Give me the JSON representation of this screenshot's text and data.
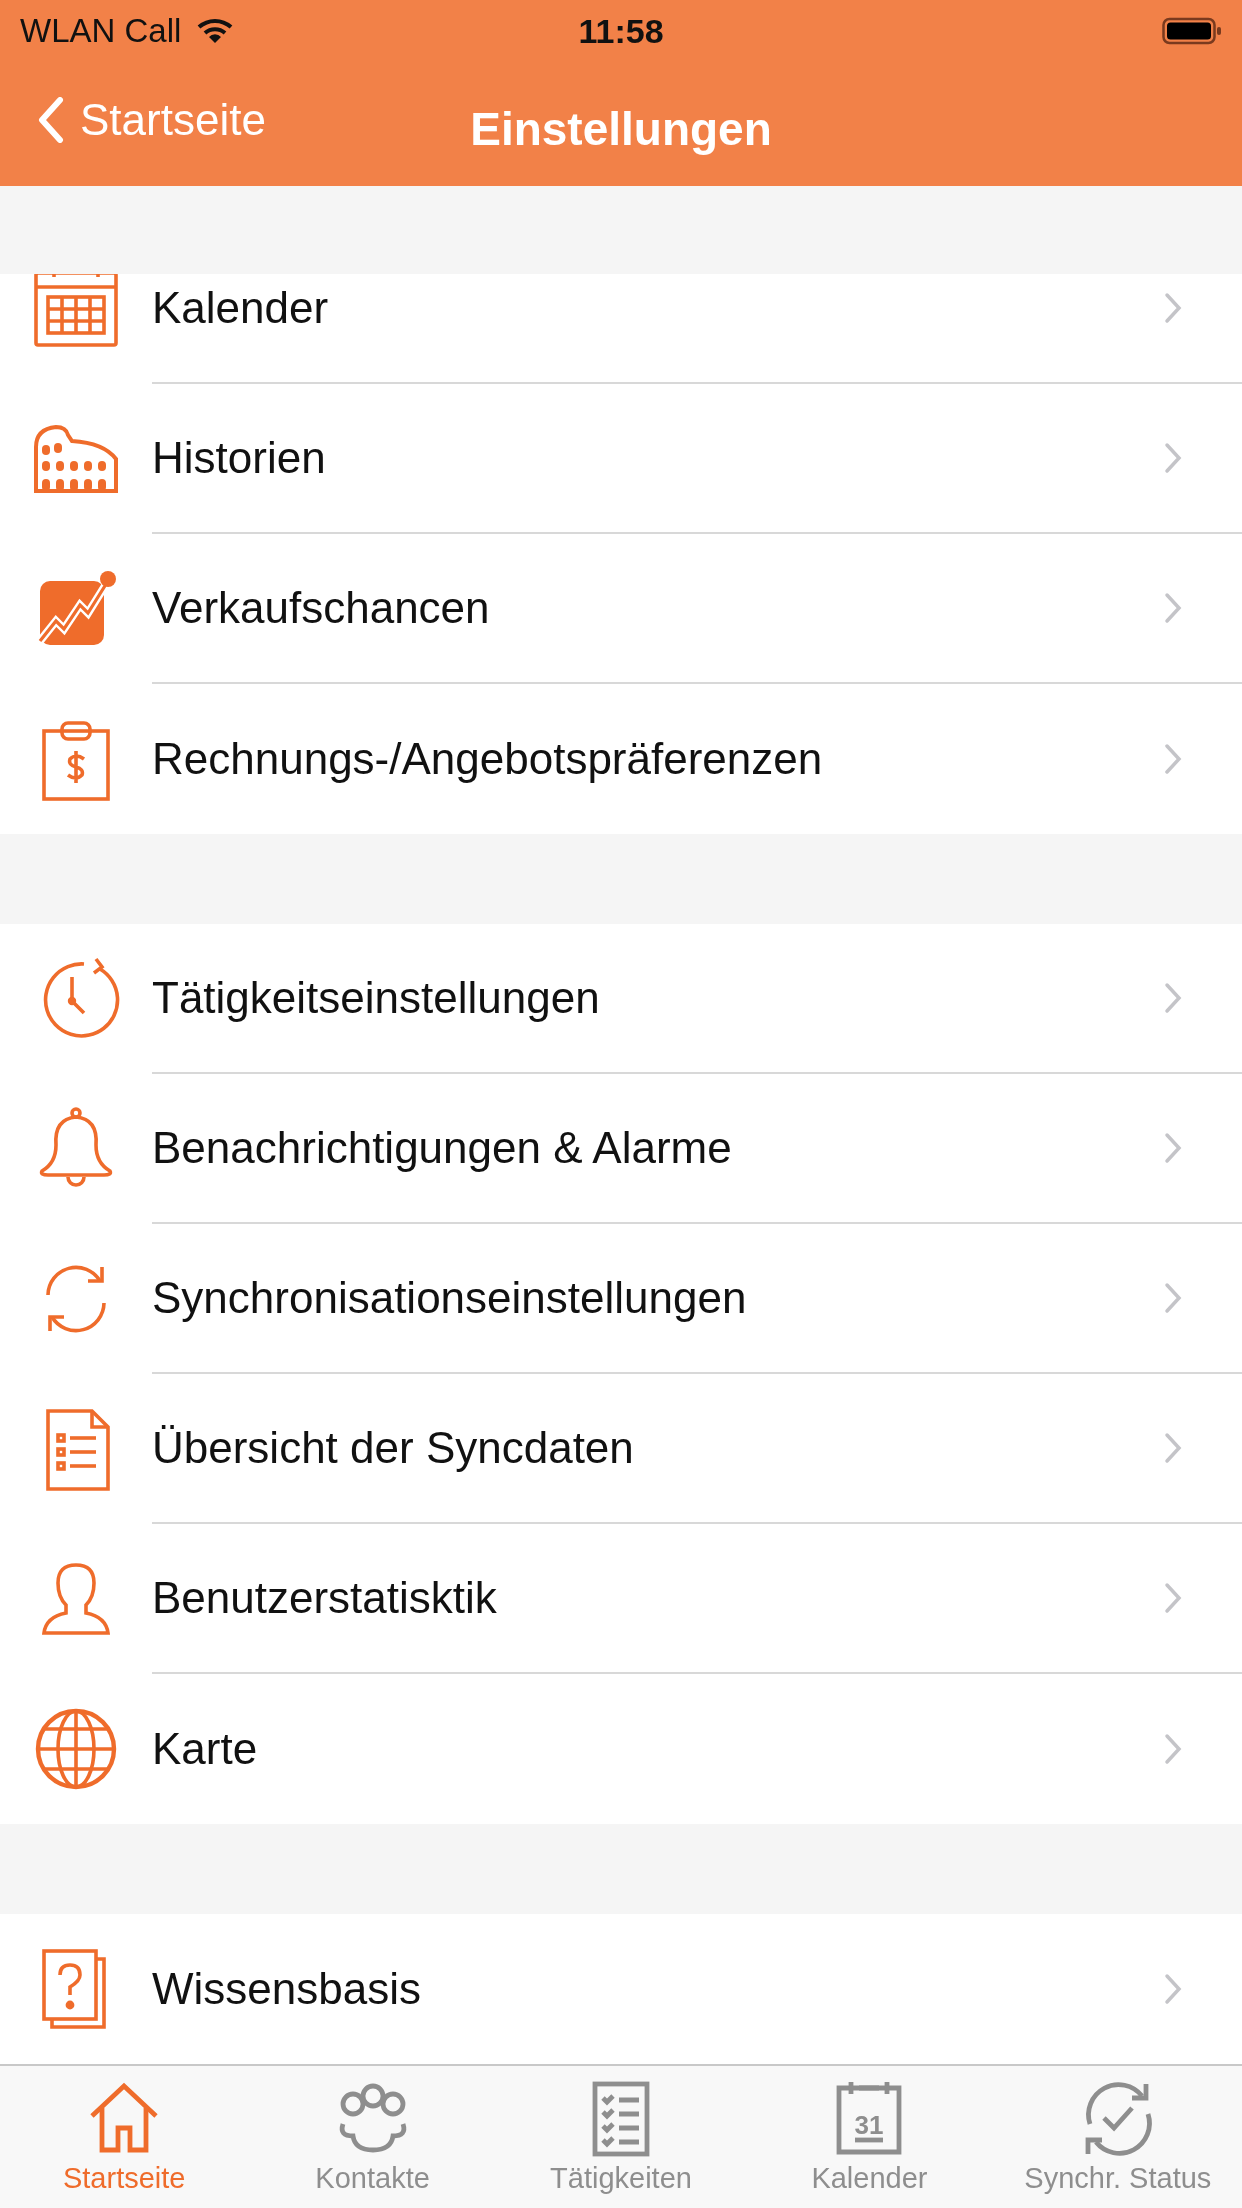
{
  "status_bar": {
    "carrier": "WLAN Call",
    "time": "11:58"
  },
  "nav": {
    "back": "Startseite",
    "title": "Einstellungen"
  },
  "sections": [
    {
      "items": [
        {
          "kind": "calendar",
          "label": "Kalender"
        },
        {
          "kind": "colosseum",
          "label": "Historien"
        },
        {
          "kind": "chart",
          "label": "Verkaufschancen"
        },
        {
          "kind": "clipboard",
          "label": "Rechnungs-/Angebotspräferenzen"
        }
      ]
    },
    {
      "items": [
        {
          "kind": "clock",
          "label": "Tätigkeitseinstellungen"
        },
        {
          "kind": "bell",
          "label": "Benachrichtigungen & Alarme"
        },
        {
          "kind": "sync",
          "label": "Synchronisationseinstellungen"
        },
        {
          "kind": "document",
          "label": "Übersicht der Syncdaten"
        },
        {
          "kind": "person",
          "label": "Benutzerstatisktik"
        },
        {
          "kind": "globe",
          "label": "Karte"
        }
      ]
    },
    {
      "items": [
        {
          "kind": "question",
          "label": "Wissensbasis"
        }
      ]
    }
  ],
  "tabs": [
    {
      "kind": "home",
      "label": "Startseite",
      "selected": true
    },
    {
      "kind": "people",
      "label": "Kontakte",
      "selected": false
    },
    {
      "kind": "checklist",
      "label": "Tätigkeiten",
      "selected": false
    },
    {
      "kind": "calendar",
      "label": "Kalender",
      "selected": false,
      "icon_text": "31"
    },
    {
      "kind": "sync",
      "label": "Synchr. Status",
      "selected": false
    }
  ]
}
